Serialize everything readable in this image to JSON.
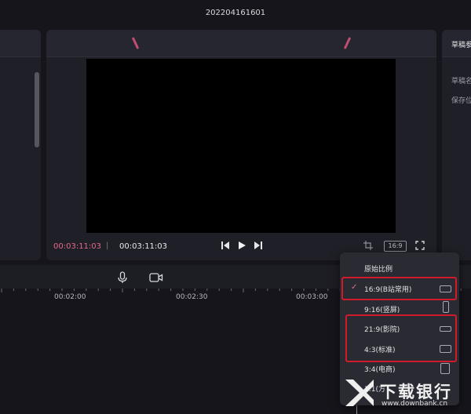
{
  "window": {
    "title": "202204161601"
  },
  "player": {
    "current_time": "00:03:11:03",
    "separator": "|",
    "total_time": "00:03:11:03",
    "ratio_button": "16:9",
    "accent_color": "#e56a8c"
  },
  "right_panel": {
    "title": "草稿参",
    "draft_name_label": "草稿名",
    "save_label": "保存位"
  },
  "timeline": {
    "ruler_labels": [
      "00:02:00",
      "00:02:30",
      "00:03:00"
    ]
  },
  "ratio_menu": {
    "items": [
      {
        "label": "原始比例",
        "selected": false
      },
      {
        "label": "16:9(B站常用)",
        "selected": true
      },
      {
        "label": "9:16(竖屏)",
        "selected": false
      },
      {
        "label": "21:9(影院)",
        "selected": false
      },
      {
        "label": "4:3(标准)",
        "selected": false
      },
      {
        "label": "3:4(电商)",
        "selected": false
      },
      {
        "label": "1:1(方",
        "selected": false
      }
    ],
    "highlight_color": "#d11a2a"
  },
  "watermark": {
    "text": "下载银行",
    "url": "www.downbank.cn"
  },
  "icons": [
    "prev-frame-icon",
    "play-icon",
    "next-frame-icon",
    "crop-icon",
    "fullscreen-icon",
    "microphone-icon",
    "record-camera-icon",
    "check-icon"
  ]
}
